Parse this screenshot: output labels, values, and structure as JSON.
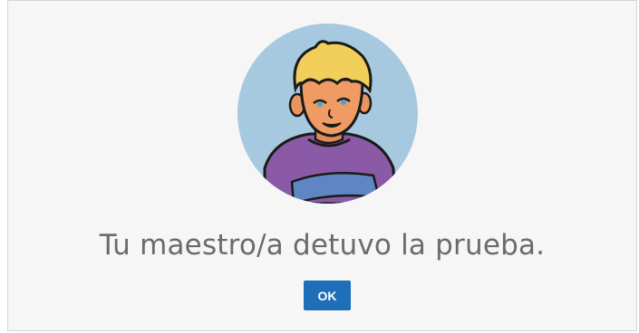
{
  "dialog": {
    "message": "Tu maestro/a detuvo la prueba.",
    "ok_label": "OK",
    "avatar_icon": "child-avatar-icon",
    "colors": {
      "avatar_background": "#a7c9df",
      "button": "#1f6eb8",
      "message_text": "#6b6b6b"
    }
  }
}
